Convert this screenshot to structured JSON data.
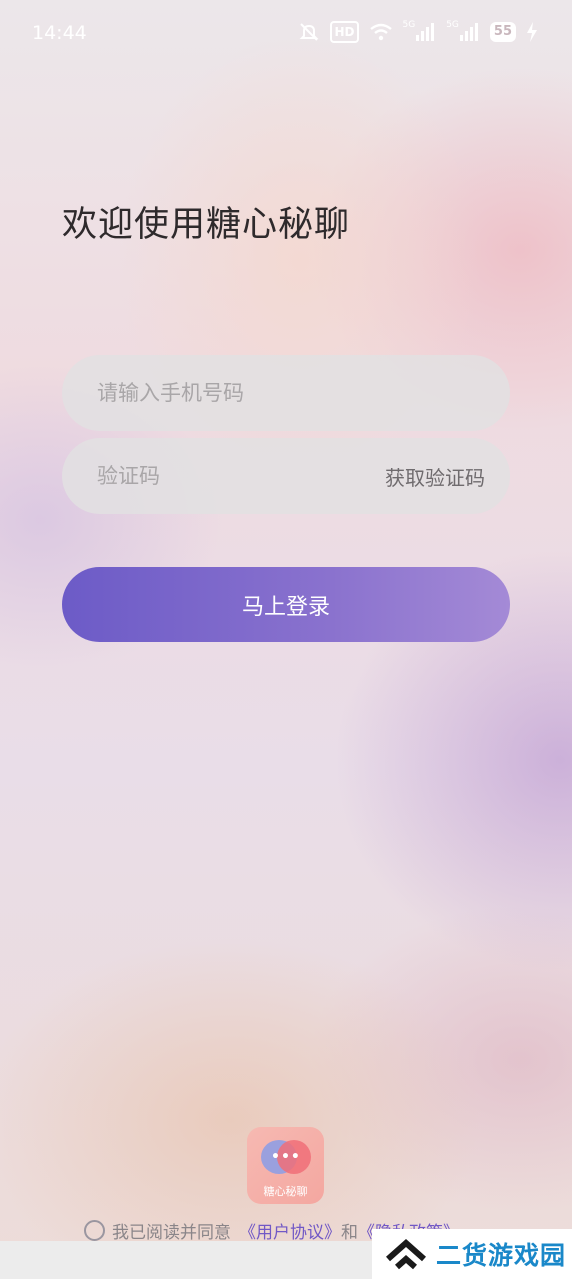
{
  "status_bar": {
    "time": "14:44",
    "icons": [
      "mute-bell-icon",
      "hd-icon",
      "wifi-icon",
      "signal-5g-icon",
      "signal-5g-icon",
      "battery-icon",
      "charging-icon"
    ],
    "hd_label": "HD",
    "signal_label_1": "5G",
    "signal_label_2": "5G",
    "battery_level": "55"
  },
  "welcome_title": "欢迎使用糖心秘聊",
  "phone_input": {
    "placeholder": "请输入手机号码",
    "value": ""
  },
  "code_input": {
    "placeholder": "验证码",
    "value": ""
  },
  "get_code_label": "获取验证码",
  "login_button_label": "马上登录",
  "app_logo": {
    "text": "糖心秘聊",
    "dots": "•••"
  },
  "agreement": {
    "prefix": "我已阅读并同意",
    "user_agreement": "《用户协议》",
    "conjunction": "和",
    "privacy_policy": "《隐私政策》",
    "checked": false
  },
  "watermark": {
    "text": "二货游戏园"
  },
  "colors": {
    "accent": "#7158c6",
    "login_gradient_start": "#6c5bc7",
    "login_gradient_end": "#a48ad6",
    "watermark": "#1a88c9"
  }
}
